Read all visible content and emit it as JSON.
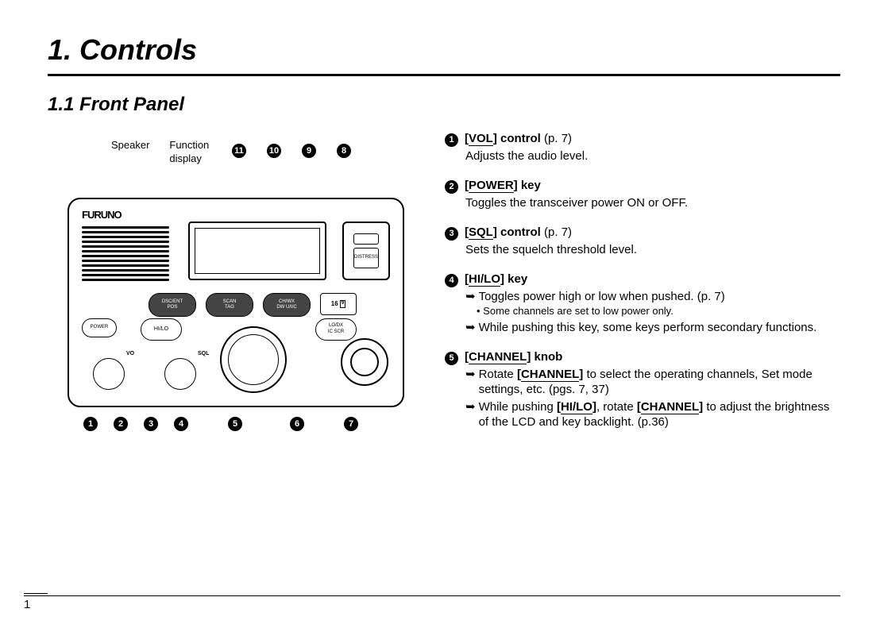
{
  "chapter": {
    "title": "1. Controls"
  },
  "section": {
    "title": "1.1 Front Panel"
  },
  "diagram": {
    "annotations": {
      "speaker": "Speaker",
      "function_display": "Function\ndisplay"
    },
    "brand": "FURUNO",
    "buttons": {
      "distress": "DISTRESS",
      "dsc_ent": "DSC/ENT",
      "pos": "POS",
      "scan": "SCAN",
      "tag": "TAG",
      "ch_wx": "CH/WX",
      "dw": "DW",
      "uic": "U/I/C",
      "sixteen": "16",
      "nine": "9",
      "power": "POWER",
      "hilo": "HI/LO",
      "lodx": "LO/DX",
      "ic": "IC",
      "scr": "SCR",
      "vo": "VO",
      "sql": "SQL"
    },
    "callouts_top": [
      "11",
      "10",
      "9",
      "8"
    ],
    "callouts_bottom": [
      "1",
      "2",
      "3",
      "4",
      "5",
      "6",
      "7"
    ]
  },
  "descriptions": [
    {
      "num": "1",
      "key": "VOL",
      "type": "control",
      "page": "(p. 7)",
      "lines": [
        {
          "kind": "plain",
          "text": "Adjusts the audio level."
        }
      ]
    },
    {
      "num": "2",
      "key": "POWER",
      "type": "key",
      "page": "",
      "lines": [
        {
          "kind": "plain",
          "text": "Toggles the transceiver power ON or OFF."
        }
      ]
    },
    {
      "num": "3",
      "key": "SQL",
      "type": "control",
      "page": "(p. 7)",
      "lines": [
        {
          "kind": "plain",
          "text": "Sets the squelch threshold level."
        }
      ]
    },
    {
      "num": "4",
      "key": "HI/LO",
      "type": "key",
      "page": "",
      "lines": [
        {
          "kind": "arrow",
          "text": "Toggles power high or low when pushed. (p. 7)"
        },
        {
          "kind": "note",
          "text": "Some channels are set to low power only."
        },
        {
          "kind": "arrow",
          "text": "While pushing this key, some keys perform secondary functions."
        }
      ]
    },
    {
      "num": "5",
      "key": "CHANNEL",
      "type": "knob",
      "page": "",
      "lines": [
        {
          "kind": "arrow",
          "pre": "Rotate ",
          "k1": "CHANNEL",
          "post": " to select the operating channels, Set mode settings, etc. (pgs. 7, 37)"
        },
        {
          "kind": "arrow",
          "pre": "While pushing ",
          "k1": "HI/LO",
          "mid": ", rotate ",
          "k2": "CHANNEL",
          "post": " to adjust the brightness of the LCD and key backlight. (p.36)"
        }
      ]
    }
  ],
  "page_number": "1"
}
